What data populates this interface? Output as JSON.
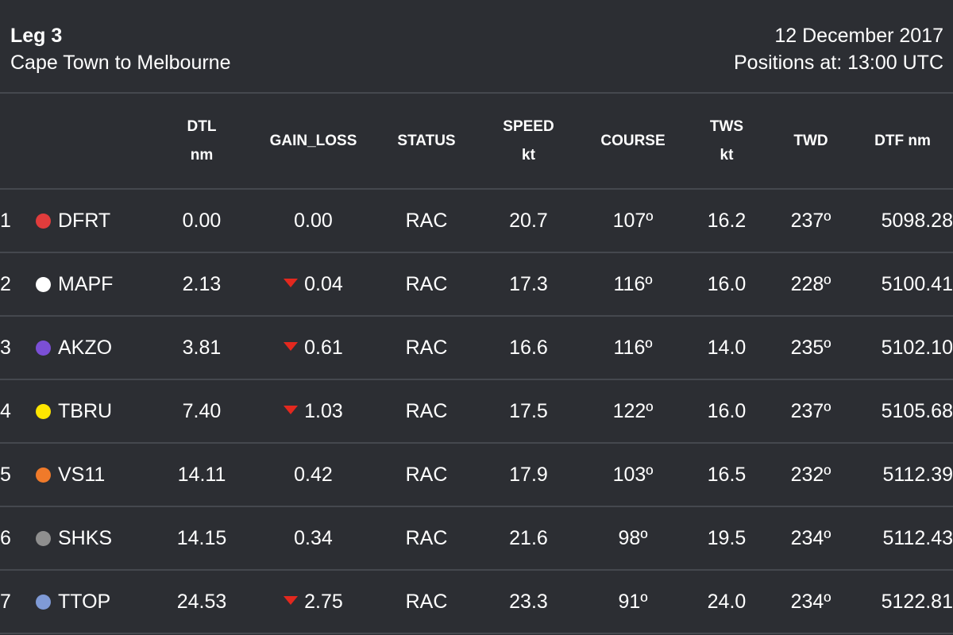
{
  "header": {
    "leg": "Leg 3",
    "route": "Cape Town to Melbourne",
    "date": "12 December 2017",
    "positions": "Positions at: 13:00 UTC"
  },
  "columns": {
    "dtl": {
      "line1": "DTL",
      "line2": "nm"
    },
    "gain_loss": "GAIN_LOSS",
    "status": "STATUS",
    "speed": {
      "line1": "SPEED",
      "line2": "kt"
    },
    "course": "COURSE",
    "tws": {
      "line1": "TWS",
      "line2": "kt"
    },
    "twd": "TWD",
    "dtf": "DTF nm"
  },
  "colors": {
    "background": "#2c2e33",
    "divider": "#45484e",
    "loss_arrow": "#e3281e"
  },
  "rows": [
    {
      "rank": "1",
      "color": "#e03c3c",
      "team": "DFRT",
      "dtl": "0.00",
      "gain_loss": "0.00",
      "loss": false,
      "status": "RAC",
      "speed": "20.7",
      "course": "107º",
      "tws": "16.2",
      "twd": "237º",
      "dtf": "5098.28"
    },
    {
      "rank": "2",
      "color": "#ffffff",
      "team": "MAPF",
      "dtl": "2.13",
      "gain_loss": "0.04",
      "loss": true,
      "status": "RAC",
      "speed": "17.3",
      "course": "116º",
      "tws": "16.0",
      "twd": "228º",
      "dtf": "5100.41"
    },
    {
      "rank": "3",
      "color": "#7b4fd6",
      "team": "AKZO",
      "dtl": "3.81",
      "gain_loss": "0.61",
      "loss": true,
      "status": "RAC",
      "speed": "16.6",
      "course": "116º",
      "tws": "14.0",
      "twd": "235º",
      "dtf": "5102.10"
    },
    {
      "rank": "4",
      "color": "#ffe600",
      "team": "TBRU",
      "dtl": "7.40",
      "gain_loss": "1.03",
      "loss": true,
      "status": "RAC",
      "speed": "17.5",
      "course": "122º",
      "tws": "16.0",
      "twd": "237º",
      "dtf": "5105.68"
    },
    {
      "rank": "5",
      "color": "#f07a2a",
      "team": "VS11",
      "dtl": "14.11",
      "gain_loss": "0.42",
      "loss": false,
      "status": "RAC",
      "speed": "17.9",
      "course": "103º",
      "tws": "16.5",
      "twd": "232º",
      "dtf": "5112.39"
    },
    {
      "rank": "6",
      "color": "#8f8f8f",
      "team": "SHKS",
      "dtl": "14.15",
      "gain_loss": "0.34",
      "loss": false,
      "status": "RAC",
      "speed": "21.6",
      "course": "98º",
      "tws": "19.5",
      "twd": "234º",
      "dtf": "5112.43"
    },
    {
      "rank": "7",
      "color": "#7f9ad6",
      "team": "TTOP",
      "dtl": "24.53",
      "gain_loss": "2.75",
      "loss": true,
      "status": "RAC",
      "speed": "23.3",
      "course": "91º",
      "tws": "24.0",
      "twd": "234º",
      "dtf": "5122.81"
    }
  ]
}
